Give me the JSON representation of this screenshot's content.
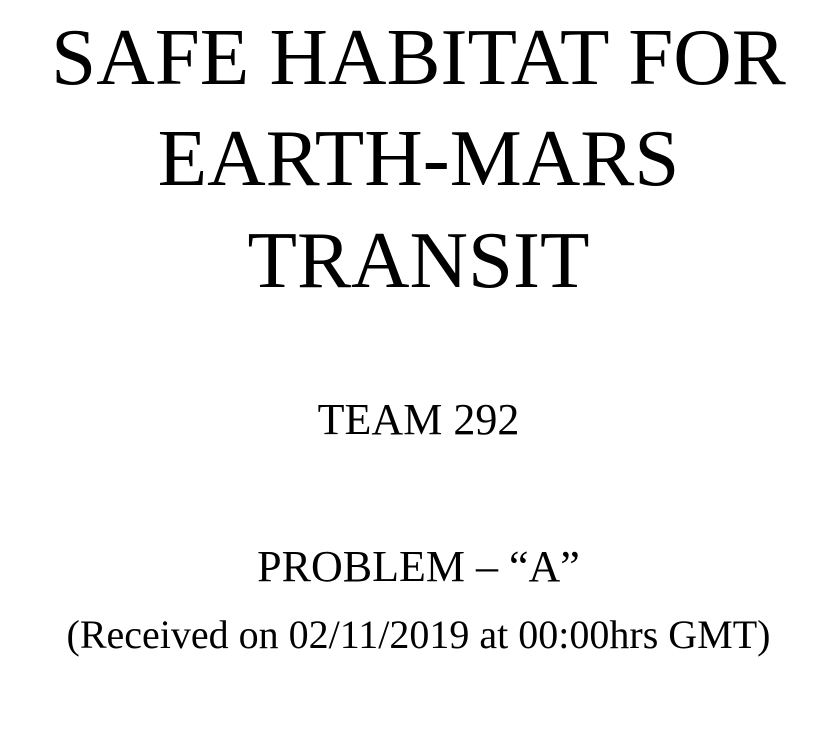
{
  "document": {
    "title_lines": [
      "SAFE HABITAT FOR",
      "EARTH-MARS",
      "TRANSIT"
    ],
    "team": "TEAM 292",
    "problem": "PROBLEM – “A”",
    "received": "(Received on 02/11/2019 at 00:00hrs GMT)"
  }
}
